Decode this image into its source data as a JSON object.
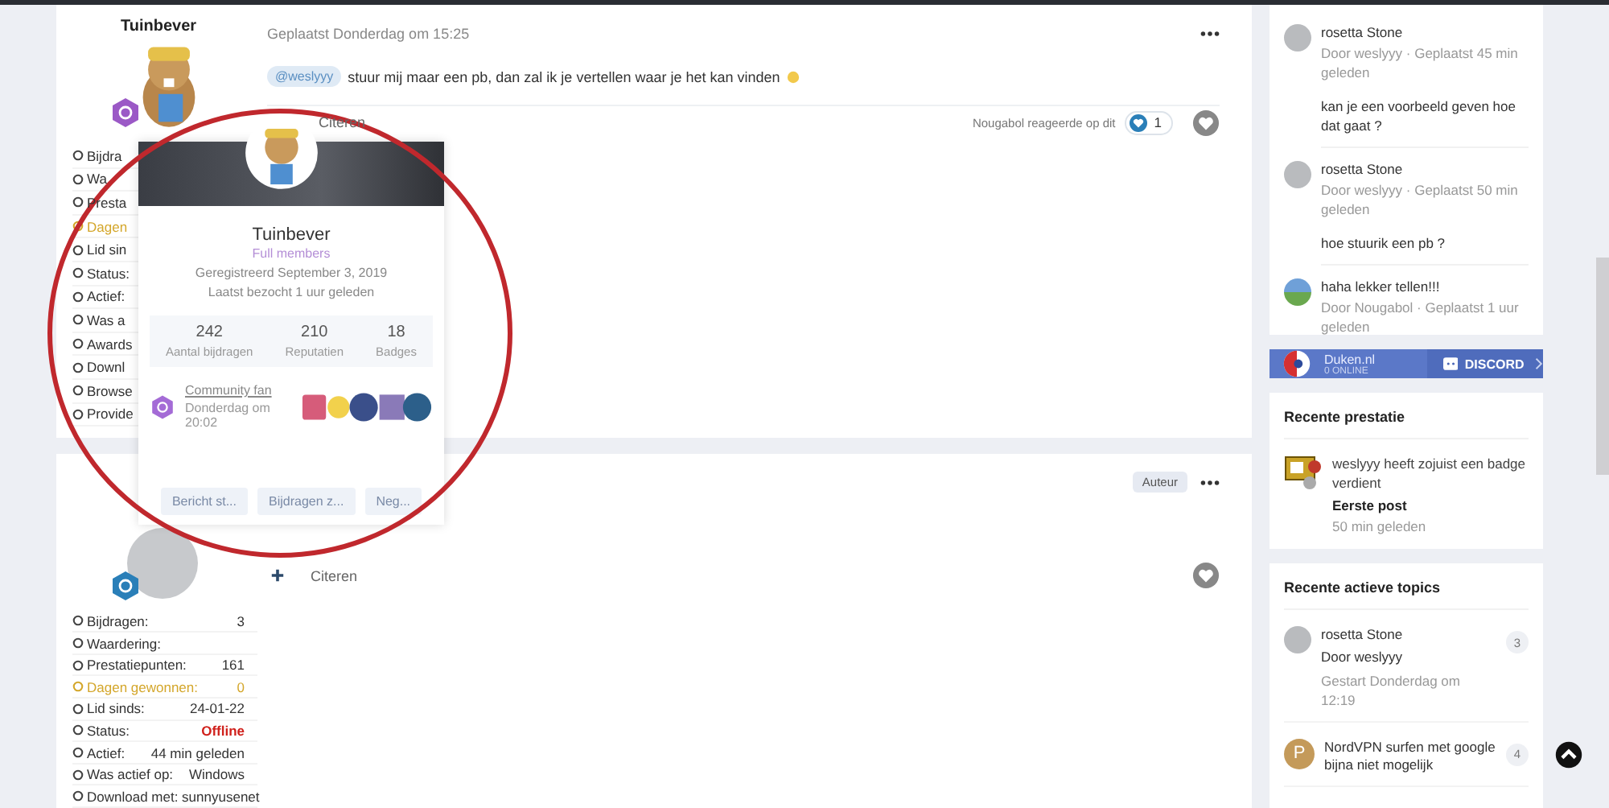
{
  "posts": [
    {
      "author": "Tuinbever",
      "color": "#9b59c6",
      "posted": "Geplaatst Donderdag om 15:25",
      "mention": "@weslyyy",
      "text": "stuur mij maar een pb, dan zal ik je vertellen waar je het kan vinden",
      "quote": "Citeren",
      "reaction_note": "Nougabol reageerde op dit",
      "reaction_count": "1",
      "stats": [
        {
          "label": "Bijdra",
          "kind": "normal"
        },
        {
          "label": "Wa",
          "kind": "normal"
        },
        {
          "label": "Presta",
          "kind": "normal"
        },
        {
          "label": "Dagen",
          "kind": "gold"
        },
        {
          "label": "Lid sin",
          "kind": "normal"
        },
        {
          "label": "Status:",
          "kind": "normal"
        },
        {
          "label": "Actief:",
          "kind": "normal"
        },
        {
          "label": "Was a",
          "kind": "normal"
        },
        {
          "label": "Awards",
          "kind": "normal"
        },
        {
          "label": "Downl",
          "kind": "normal"
        },
        {
          "label": "Browse",
          "kind": "normal"
        },
        {
          "label": "Provide",
          "kind": "normal"
        }
      ]
    },
    {
      "color": "#2a7fb8",
      "tag": "Auteur",
      "quote": "Citeren",
      "stats": [
        {
          "label": "Bijdragen:",
          "value": "3",
          "kind": "normal"
        },
        {
          "label": "Waardering:",
          "kind": "normal"
        },
        {
          "label": "Prestatiepunten:",
          "value": "161",
          "kind": "normal"
        },
        {
          "label": "Dagen gewonnen:",
          "value": "0",
          "kind": "gold"
        },
        {
          "label": "Lid sinds:",
          "value": "24-01-22",
          "kind": "normal"
        },
        {
          "label": "Status:",
          "value": "Offline",
          "kind": "alert"
        },
        {
          "label": "Actief:",
          "value": "44 min geleden",
          "kind": "normal"
        },
        {
          "label": "Was actief op:",
          "value": "Windows",
          "kind": "normal"
        },
        {
          "label": "Download met: sunnyusenet",
          "kind": "normal"
        }
      ]
    }
  ],
  "popup": {
    "name": "Tuinbever",
    "group": "Full members",
    "registered": "Geregistreerd September 3, 2019",
    "last_visit": "Laatst bezocht 1 uur geleden",
    "stats": [
      {
        "value": "242",
        "label": "Aantal bijdragen"
      },
      {
        "value": "210",
        "label": "Reputatien"
      },
      {
        "value": "18",
        "label": "Badges"
      }
    ],
    "latest_badge": {
      "title": "Community fan",
      "date": "Donderdag om 20:02"
    },
    "buttons": [
      "Bericht st...",
      "Bijdragen z...",
      "Neg..."
    ]
  },
  "sidebar": {
    "comments": [
      {
        "title": "rosetta Stone",
        "meta": "Door weslyyy · Geplaatst 45 min geleden",
        "body": "kan je een voorbeeld geven hoe dat gaat ?",
        "kind": "photo"
      },
      {
        "title": "rosetta Stone",
        "meta": "Door weslyyy · Geplaatst 50 min geleden",
        "body": "hoe stuurik een pb ?",
        "kind": "photo"
      },
      {
        "title": "haha lekker tellen!!!",
        "meta": "Door Nougabol · Geplaatst 1 uur geleden",
        "kind": "landscape"
      }
    ],
    "discord": {
      "site": "Duken.nl",
      "online": "0 ONLINE",
      "label": "DISCORD"
    },
    "achievements": {
      "title": "Recente prestatie",
      "items": [
        {
          "text": "weslyyy heeft zojuist een badge verdient",
          "badge": "Eerste post",
          "time": "50 min geleden"
        }
      ]
    },
    "topics": {
      "title": "Recente actieve topics",
      "items": [
        {
          "title": "rosetta Stone",
          "starter": "Door weslyyy",
          "started": "Gestart Donderdag om 12:19",
          "count": "3",
          "kind": "photo"
        },
        {
          "title": "NordVPN surfen met google bijna niet mogelijk",
          "count": "4",
          "kind": "letter",
          "letter": "P"
        }
      ]
    }
  }
}
